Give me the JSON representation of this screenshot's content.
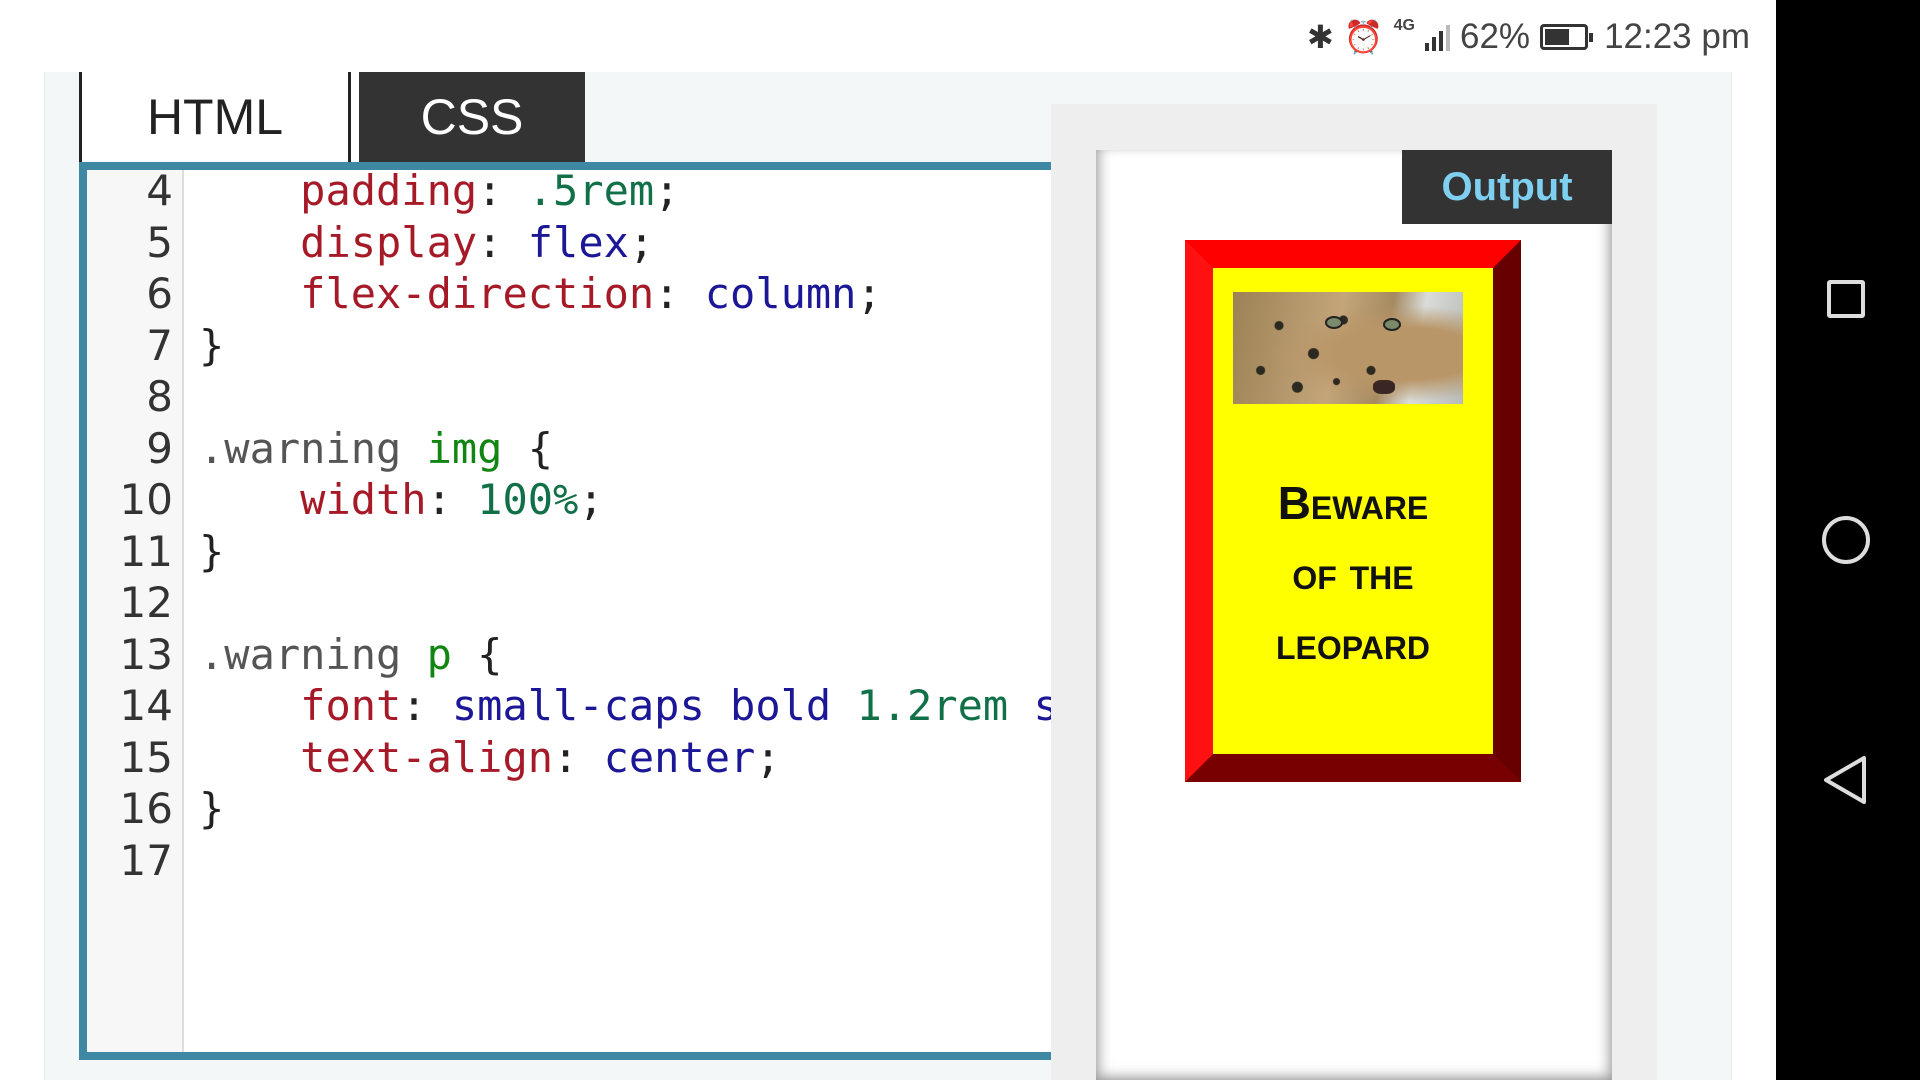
{
  "status_bar": {
    "bluetooth_icon": "bluetooth-icon",
    "alarm_icon": "alarm-icon",
    "network": "4G",
    "battery_percent": "62%",
    "battery_level": 0.62,
    "time": "12:23 pm"
  },
  "tabs": [
    {
      "label": "HTML",
      "active": false
    },
    {
      "label": "CSS",
      "active": true
    }
  ],
  "editor": {
    "lines": [
      {
        "n": "4",
        "tokens": [
          [
            "    ",
            "punc"
          ],
          [
            "padding",
            "prop"
          ],
          [
            ": ",
            "punc"
          ],
          [
            ".5rem",
            "num"
          ],
          [
            ";",
            "punc"
          ]
        ]
      },
      {
        "n": "5",
        "tokens": [
          [
            "    ",
            "punc"
          ],
          [
            "display",
            "prop"
          ],
          [
            ": ",
            "punc"
          ],
          [
            "flex",
            "val"
          ],
          [
            ";",
            "punc"
          ]
        ]
      },
      {
        "n": "6",
        "tokens": [
          [
            "    ",
            "punc"
          ],
          [
            "flex-direction",
            "prop"
          ],
          [
            ": ",
            "punc"
          ],
          [
            "column",
            "val"
          ],
          [
            ";",
            "punc"
          ]
        ]
      },
      {
        "n": "7",
        "tokens": [
          [
            "}",
            "punc"
          ]
        ]
      },
      {
        "n": "8",
        "tokens": []
      },
      {
        "n": "9",
        "tokens": [
          [
            ".warning ",
            "sel"
          ],
          [
            "img",
            "tag"
          ],
          [
            " {",
            "punc"
          ]
        ]
      },
      {
        "n": "10",
        "tokens": [
          [
            "    ",
            "punc"
          ],
          [
            "width",
            "prop"
          ],
          [
            ": ",
            "punc"
          ],
          [
            "100%",
            "num"
          ],
          [
            ";",
            "punc"
          ]
        ]
      },
      {
        "n": "11",
        "tokens": [
          [
            "}",
            "punc"
          ]
        ]
      },
      {
        "n": "12",
        "tokens": []
      },
      {
        "n": "13",
        "tokens": [
          [
            ".warning ",
            "sel"
          ],
          [
            "p",
            "tag"
          ],
          [
            " {",
            "punc"
          ]
        ]
      },
      {
        "n": "14",
        "tokens": [
          [
            "    ",
            "punc"
          ],
          [
            "font",
            "prop"
          ],
          [
            ": ",
            "punc"
          ],
          [
            "small-caps bold ",
            "val"
          ],
          [
            "1.2rem",
            "num"
          ],
          [
            " s",
            "val"
          ]
        ]
      },
      {
        "n": "15",
        "tokens": [
          [
            "    ",
            "punc"
          ],
          [
            "text-align",
            "prop"
          ],
          [
            ": ",
            "punc"
          ],
          [
            "center",
            "val"
          ],
          [
            ";",
            "punc"
          ]
        ]
      },
      {
        "n": "16",
        "tokens": [
          [
            "}",
            "punc"
          ]
        ]
      },
      {
        "n": "17",
        "tokens": []
      }
    ]
  },
  "output": {
    "label": "Output",
    "warning_line1": "Beware",
    "warning_line2": "of the",
    "warning_line3": "leopard",
    "image_icon": "leopard-image"
  },
  "navbar": {
    "recent_icon": "square-icon",
    "home_icon": "circle-icon",
    "back_icon": "triangle-back-icon"
  },
  "colors": {
    "editor_border": "#3f88a4",
    "warning_bg": "#ffff00",
    "warning_border": "#ee0000",
    "output_label_text": "#7fd0f0"
  }
}
